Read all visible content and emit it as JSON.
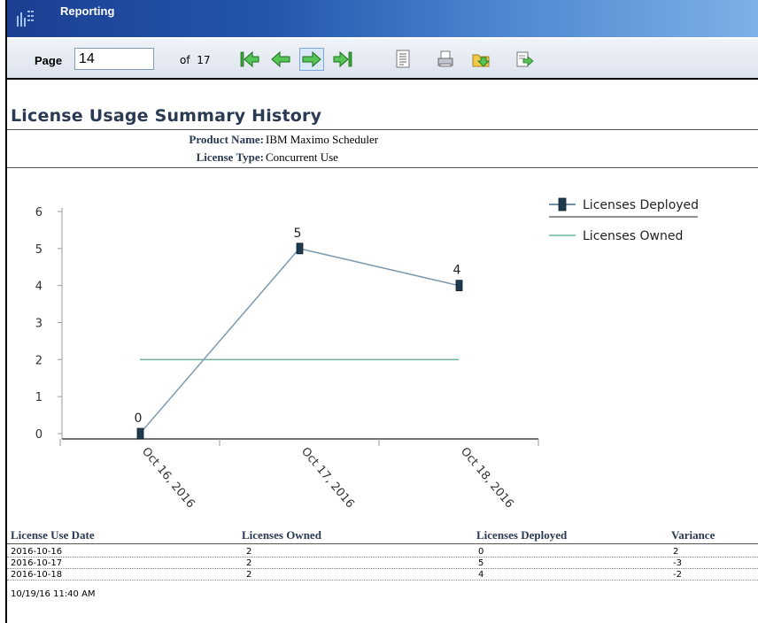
{
  "app": {
    "title": "Reporting",
    "icon": "report-grid-icon"
  },
  "toolbar": {
    "page_label": "Page",
    "page_value": "14",
    "of_label": "of",
    "total_pages": "17",
    "buttons": [
      "first-page-icon",
      "previous-page-icon",
      "next-page-icon",
      "last-page-icon",
      "toc-icon",
      "print-icon",
      "export-data-icon",
      "export-report-icon"
    ]
  },
  "report": {
    "title": "License Usage Summary History",
    "product_label": "Product Name:",
    "product_value": "IBM Maximo Scheduler",
    "license_label": "License Type:",
    "license_value": "Concurrent Use"
  },
  "chart_data": {
    "type": "line",
    "categories": [
      "Oct 16, 2016",
      "Oct 17, 2016",
      "Oct 18, 2016"
    ],
    "series": [
      {
        "name": "Licenses Deployed",
        "values": [
          0,
          5,
          4
        ],
        "color": "#7f9bb0",
        "marker_color": "#1f3b4f"
      },
      {
        "name": "Licenses Owned",
        "values": [
          2,
          2,
          2
        ],
        "color": "#6ab39b"
      }
    ],
    "ylim": [
      0,
      6
    ],
    "yticks": [
      "0",
      "1",
      "2",
      "3",
      "4",
      "5",
      "6"
    ],
    "data_labels": [
      "0",
      "5",
      "4"
    ],
    "legend": "top-right"
  },
  "table": {
    "headers": [
      "License Use Date",
      "Licenses Owned",
      "Licenses Deployed",
      "Variance"
    ],
    "rows": [
      [
        "2016-10-16",
        "2",
        "0",
        "2"
      ],
      [
        "2016-10-17",
        "2",
        "5",
        "-3"
      ],
      [
        "2016-10-18",
        "2",
        "4",
        "-2"
      ]
    ]
  },
  "footer": {
    "timestamp": "10/19/16 11:40 AM"
  }
}
